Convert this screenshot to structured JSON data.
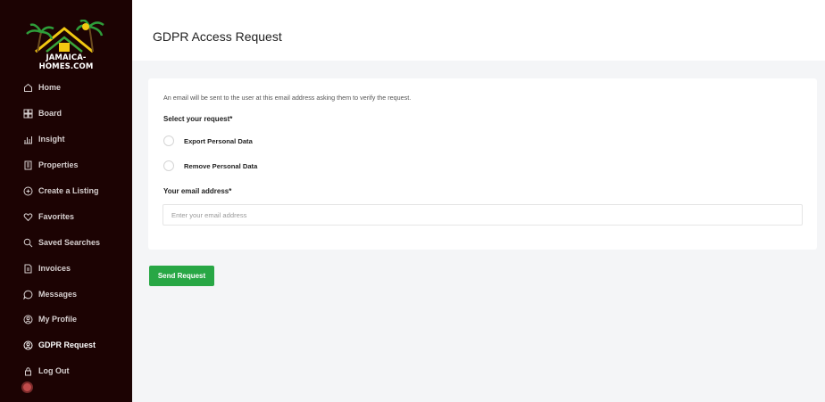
{
  "brand": {
    "logo_text": "JAMAICA-HOMES.COM"
  },
  "sidebar": {
    "items": [
      {
        "label": "Home",
        "icon": "home-icon"
      },
      {
        "label": "Board",
        "icon": "board-icon"
      },
      {
        "label": "Insight",
        "icon": "insight-icon"
      },
      {
        "label": "Properties",
        "icon": "properties-icon"
      },
      {
        "label": "Create a Listing",
        "icon": "plus-circle-icon"
      },
      {
        "label": "Favorites",
        "icon": "heart-icon"
      },
      {
        "label": "Saved Searches",
        "icon": "search-icon"
      },
      {
        "label": "Invoices",
        "icon": "invoice-icon"
      },
      {
        "label": "Messages",
        "icon": "chat-icon"
      },
      {
        "label": "My Profile",
        "icon": "profile-icon"
      },
      {
        "label": "GDPR Request",
        "icon": "gdpr-icon",
        "active": true
      },
      {
        "label": "Log Out",
        "icon": "logout-icon"
      }
    ]
  },
  "header": {
    "title": "GDPR Access Request"
  },
  "form": {
    "info": "An email will be sent to the user at this email address asking them to verify the request.",
    "select_label": "Select your request*",
    "options": [
      {
        "label": "Export Personal Data",
        "selected": false
      },
      {
        "label": "Remove Personal Data",
        "selected": false
      }
    ],
    "email_label": "Your email address*",
    "email_placeholder": "Enter your email address",
    "email_value": "",
    "submit_label": "Send Request"
  },
  "colors": {
    "sidebar_bg": "#1c0303",
    "accent_green": "#28a745",
    "page_bg": "#f4f5f7"
  }
}
